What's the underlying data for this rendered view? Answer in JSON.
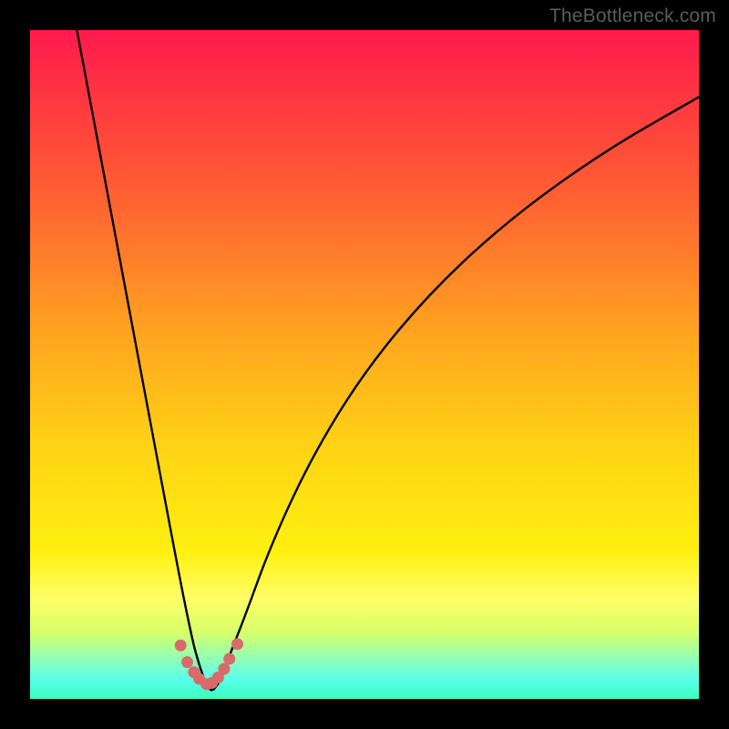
{
  "watermark": "TheBottleneck.com",
  "chart_data": {
    "type": "line",
    "title": "",
    "xlabel": "",
    "ylabel": "",
    "xlim": [
      0,
      100
    ],
    "ylim": [
      0,
      100
    ],
    "note": "Axes are unlabeled; values below are pixel-read estimates normalized to 0–100 within the plot area. The V-shaped curve dips to ~0 near x≈27 and rises on both sides.",
    "series": [
      {
        "name": "curve",
        "x": [
          7,
          10,
          13,
          16,
          19,
          22,
          24,
          25,
          26,
          27,
          28,
          29,
          30,
          32,
          36,
          42,
          50,
          60,
          72,
          86,
          100
        ],
        "values": [
          100,
          84,
          68,
          52,
          36,
          20,
          10,
          6,
          3,
          1,
          2,
          4,
          7,
          12,
          23,
          36,
          49,
          61,
          72,
          82,
          90
        ]
      }
    ],
    "scatter": {
      "name": "points-near-minimum",
      "x": [
        22.5,
        23.5,
        24.5,
        25.3,
        26.4,
        27.2,
        28.1,
        29.0,
        29.8,
        31.0
      ],
      "values": [
        8.0,
        5.5,
        4.0,
        3.0,
        2.2,
        2.4,
        3.2,
        4.5,
        6.0,
        8.2
      ]
    }
  },
  "colors": {
    "curve": "#000000",
    "dots": "#d86a6a",
    "gradient_top": "#ff1a4d",
    "gradient_bottom": "#3bffc0"
  }
}
